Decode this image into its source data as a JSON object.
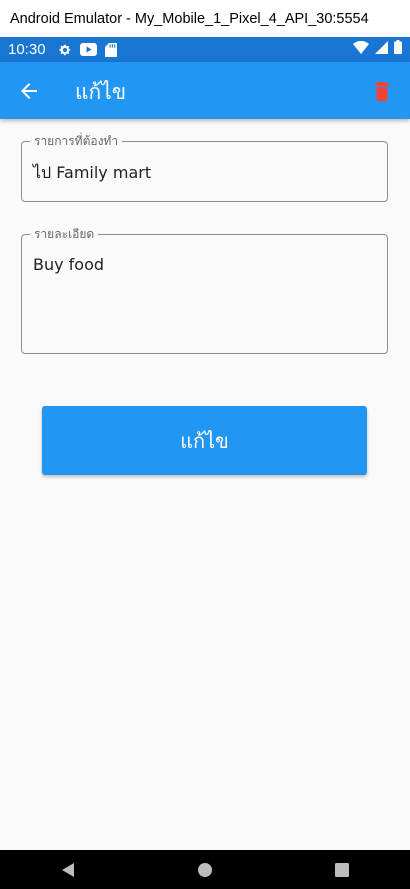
{
  "window": {
    "title": "Android Emulator - My_Mobile_1_Pixel_4_API_30:5554"
  },
  "status_bar": {
    "time": "10:30",
    "left_icons": [
      "gear-icon",
      "youtube-icon",
      "sd-card-icon"
    ],
    "right_icons": [
      "wifi-icon",
      "cell-signal-icon",
      "battery-icon"
    ]
  },
  "app_bar": {
    "title": "แก้ไข",
    "back_icon": "arrow-left-icon",
    "delete_icon": "trash-icon",
    "color": "#2196f3"
  },
  "form": {
    "task_field": {
      "label": "รายการที่ต้องทำ",
      "value": "ไป Family mart"
    },
    "detail_field": {
      "label": "รายละเอียด",
      "value": "Buy food"
    }
  },
  "submit_button": {
    "label": "แก้ไข",
    "color": "#2196f3"
  },
  "nav_bar": {
    "icons": [
      "back-triangle-icon",
      "home-circle-icon",
      "recents-square-icon"
    ]
  }
}
